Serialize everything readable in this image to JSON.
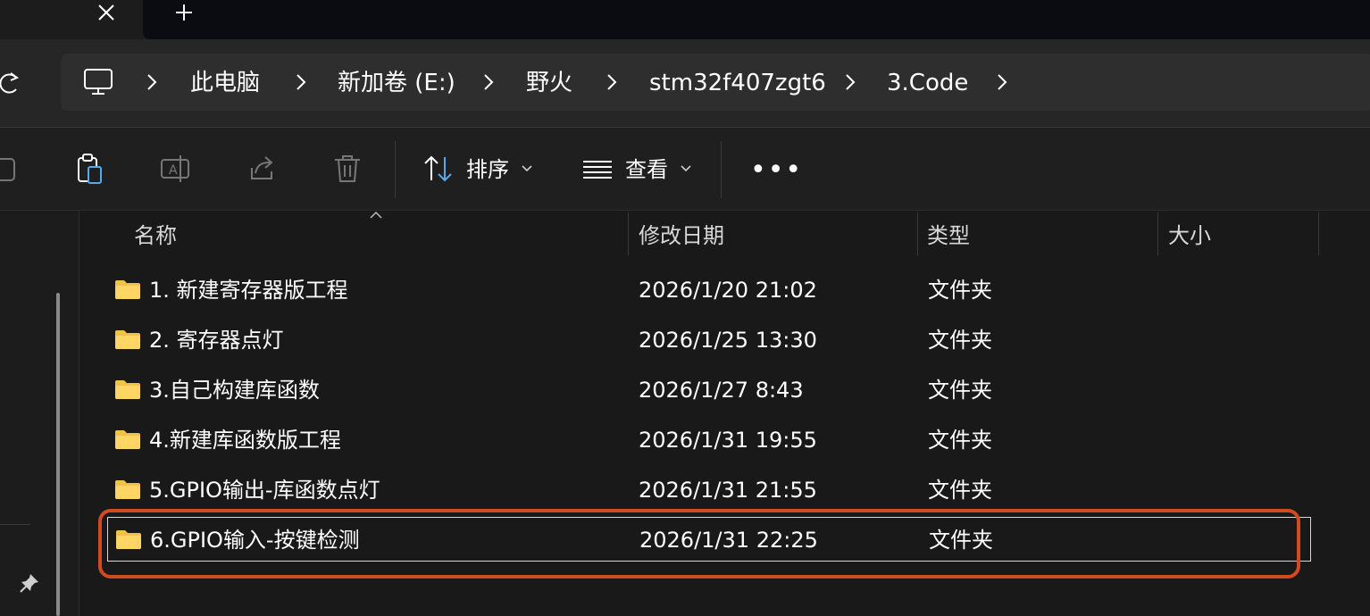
{
  "window": {
    "tab_new_symbol": "+"
  },
  "breadcrumb": {
    "items": [
      {
        "label": "此电脑"
      },
      {
        "label": "新加卷 (E:)"
      },
      {
        "label": "野火"
      },
      {
        "label": "stm32f407zgt6"
      },
      {
        "label": "3.Code"
      }
    ]
  },
  "toolbar": {
    "sort_label": "排序",
    "view_label": "查看",
    "more_label": "•••"
  },
  "columns": {
    "name": "名称",
    "date": "修改日期",
    "type": "类型",
    "size": "大小"
  },
  "files": [
    {
      "name": "1. 新建寄存器版工程",
      "date": "2026/1/20 21:02",
      "type": "文件夹",
      "size": ""
    },
    {
      "name": "2. 寄存器点灯",
      "date": "2026/1/25 13:30",
      "type": "文件夹",
      "size": ""
    },
    {
      "name": "3.自己构建库函数",
      "date": "2026/1/27 8:43",
      "type": "文件夹",
      "size": ""
    },
    {
      "name": "4.新建库函数版工程",
      "date": "2026/1/31 19:55",
      "type": "文件夹",
      "size": ""
    },
    {
      "name": "5.GPIO输出-库函数点灯",
      "date": "2026/1/31 21:55",
      "type": "文件夹",
      "size": ""
    },
    {
      "name": "6.GPIO输入-按键检测",
      "date": "2026/1/31 22:25",
      "type": "文件夹",
      "size": ""
    }
  ],
  "colors": {
    "folder": "#f2c14b",
    "highlight": "#d24a22",
    "accent_icon": "#5ba8e6"
  },
  "icons": [
    "close-icon",
    "plus-icon",
    "refresh-icon",
    "computer-icon",
    "chevron-right-icon",
    "copy-icon",
    "paste-icon",
    "rename-icon",
    "share-icon",
    "delete-icon",
    "sort-icon",
    "view-icon",
    "more-icon",
    "pin-icon",
    "folder-icon"
  ]
}
